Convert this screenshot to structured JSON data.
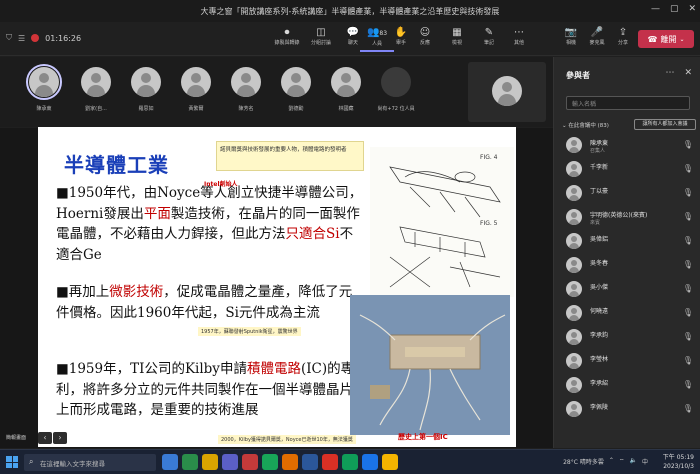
{
  "window": {
    "title": "大專之窗「開放講座系列-系統講座」半導體產業，半導體產業之沿革歷史與技術發展",
    "controls": [
      "—",
      "▢",
      "✕"
    ]
  },
  "toolbar": {
    "recording_time": "01:16:26",
    "tools": [
      {
        "label": "錄製與轉錄",
        "icon": "⏺"
      },
      {
        "label": "分組討論",
        "icon": "◫"
      },
      {
        "label": "聊天",
        "icon": "💬"
      },
      {
        "label": "人員",
        "icon": "👥",
        "count": "83"
      },
      {
        "label": "舉手",
        "icon": "✋"
      },
      {
        "label": "反應",
        "icon": "☺"
      },
      {
        "label": "檢視",
        "icon": "▦"
      },
      {
        "label": "筆記",
        "icon": "✎"
      },
      {
        "label": "其他",
        "icon": "⋯"
      },
      {
        "label": "相機",
        "icon": "📷"
      },
      {
        "label": "麥克風",
        "icon": "🎤"
      },
      {
        "label": "分享",
        "icon": "⇪"
      }
    ],
    "leave_label": "離開"
  },
  "strip": {
    "participants": [
      {
        "name": "陳承東",
        "active": true
      },
      {
        "name": "劉家(自...",
        "active": false
      },
      {
        "name": "羅思如",
        "active": false
      },
      {
        "name": "黃繁爾",
        "active": false
      },
      {
        "name": "陳芳名",
        "active": false
      },
      {
        "name": "劉德勳",
        "active": false
      },
      {
        "name": "林國藏",
        "active": false
      },
      {
        "name": "尚有+72 位人員",
        "active": false
      }
    ]
  },
  "slide": {
    "title": "半導體工業",
    "note": "諾貝爾獎與技術發展的重要人物，積體電路的發明者",
    "founder_label": "Intel創始人",
    "bullet1_a": "■1950年代，由Noyce等人創立快捷半導體公司，Hoerni發展出",
    "bullet1_hl": "平面",
    "bullet1_b": "製造技術，在晶片的同一面製作電晶體，不必藉由人力銲接，但此方法",
    "bullet1_hl2": "只適合Si",
    "bullet1_c": "不適合Ge",
    "bullet2_a": "■再加上",
    "bullet2_hl": "微影技術",
    "bullet2_b": "，促成電晶體之量產，降低了元件價格。因此1960年代起，Si元件成為主流",
    "bullet3_a": "■1959年，TI公司的Kilby申請",
    "bullet3_hl": "積體電路",
    "bullet3_b": "(IC)的專利，將許多分立的元件共同製作在一個半導體晶片上而形成電路，是重要的技術進展",
    "caption1": "1957年，蘇聯發射Sputnik衛星，震驚世界",
    "caption2": "2000，Kilby獲得諾貝爾獎，Noyce已逝世10年，無法獲獎",
    "caption3": "歷史上第一個IC"
  },
  "bottom": {
    "label": "簡報畫面",
    "prev": "‹",
    "next": "›"
  },
  "panel": {
    "title": "參與者",
    "search_placeholder": "輸入名稱",
    "section_label": "⌄ 在此會議中 (83)",
    "admit_all_label": "讓所有人都加入會議",
    "people": [
      {
        "name": "陳承東",
        "role": "召集人"
      },
      {
        "name": "千李新",
        "role": ""
      },
      {
        "name": "丁以豪",
        "role": ""
      },
      {
        "name": "宇明德(英德公)(來賓)",
        "role": "來賓"
      },
      {
        "name": "吳偉鋁",
        "role": ""
      },
      {
        "name": "吳冬春",
        "role": ""
      },
      {
        "name": "吳小傑",
        "role": ""
      },
      {
        "name": "何曉遠",
        "role": ""
      },
      {
        "name": "李承鈞",
        "role": ""
      },
      {
        "name": "李瑩林",
        "role": ""
      },
      {
        "name": "李承紹",
        "role": ""
      },
      {
        "name": "李佩陵",
        "role": ""
      }
    ]
  },
  "taskbar": {
    "search_placeholder": "在這裡輸入文字來搜尋",
    "weather": "28°C 晴時多雲",
    "lang": "中",
    "time": "下午 05:19",
    "date": "2023/10/3",
    "apps": [
      {
        "color": "#3a7bd5"
      },
      {
        "color": "#2a8d4a"
      },
      {
        "color": "#d9a400"
      },
      {
        "color": "#5b5fc7"
      },
      {
        "color": "#c43a3a"
      },
      {
        "color": "#18a558"
      },
      {
        "color": "#e06c00"
      },
      {
        "color": "#2b579a"
      },
      {
        "color": "#d93025"
      },
      {
        "color": "#0f9d58"
      },
      {
        "color": "#1a73e8"
      },
      {
        "color": "#f4b400"
      }
    ]
  }
}
